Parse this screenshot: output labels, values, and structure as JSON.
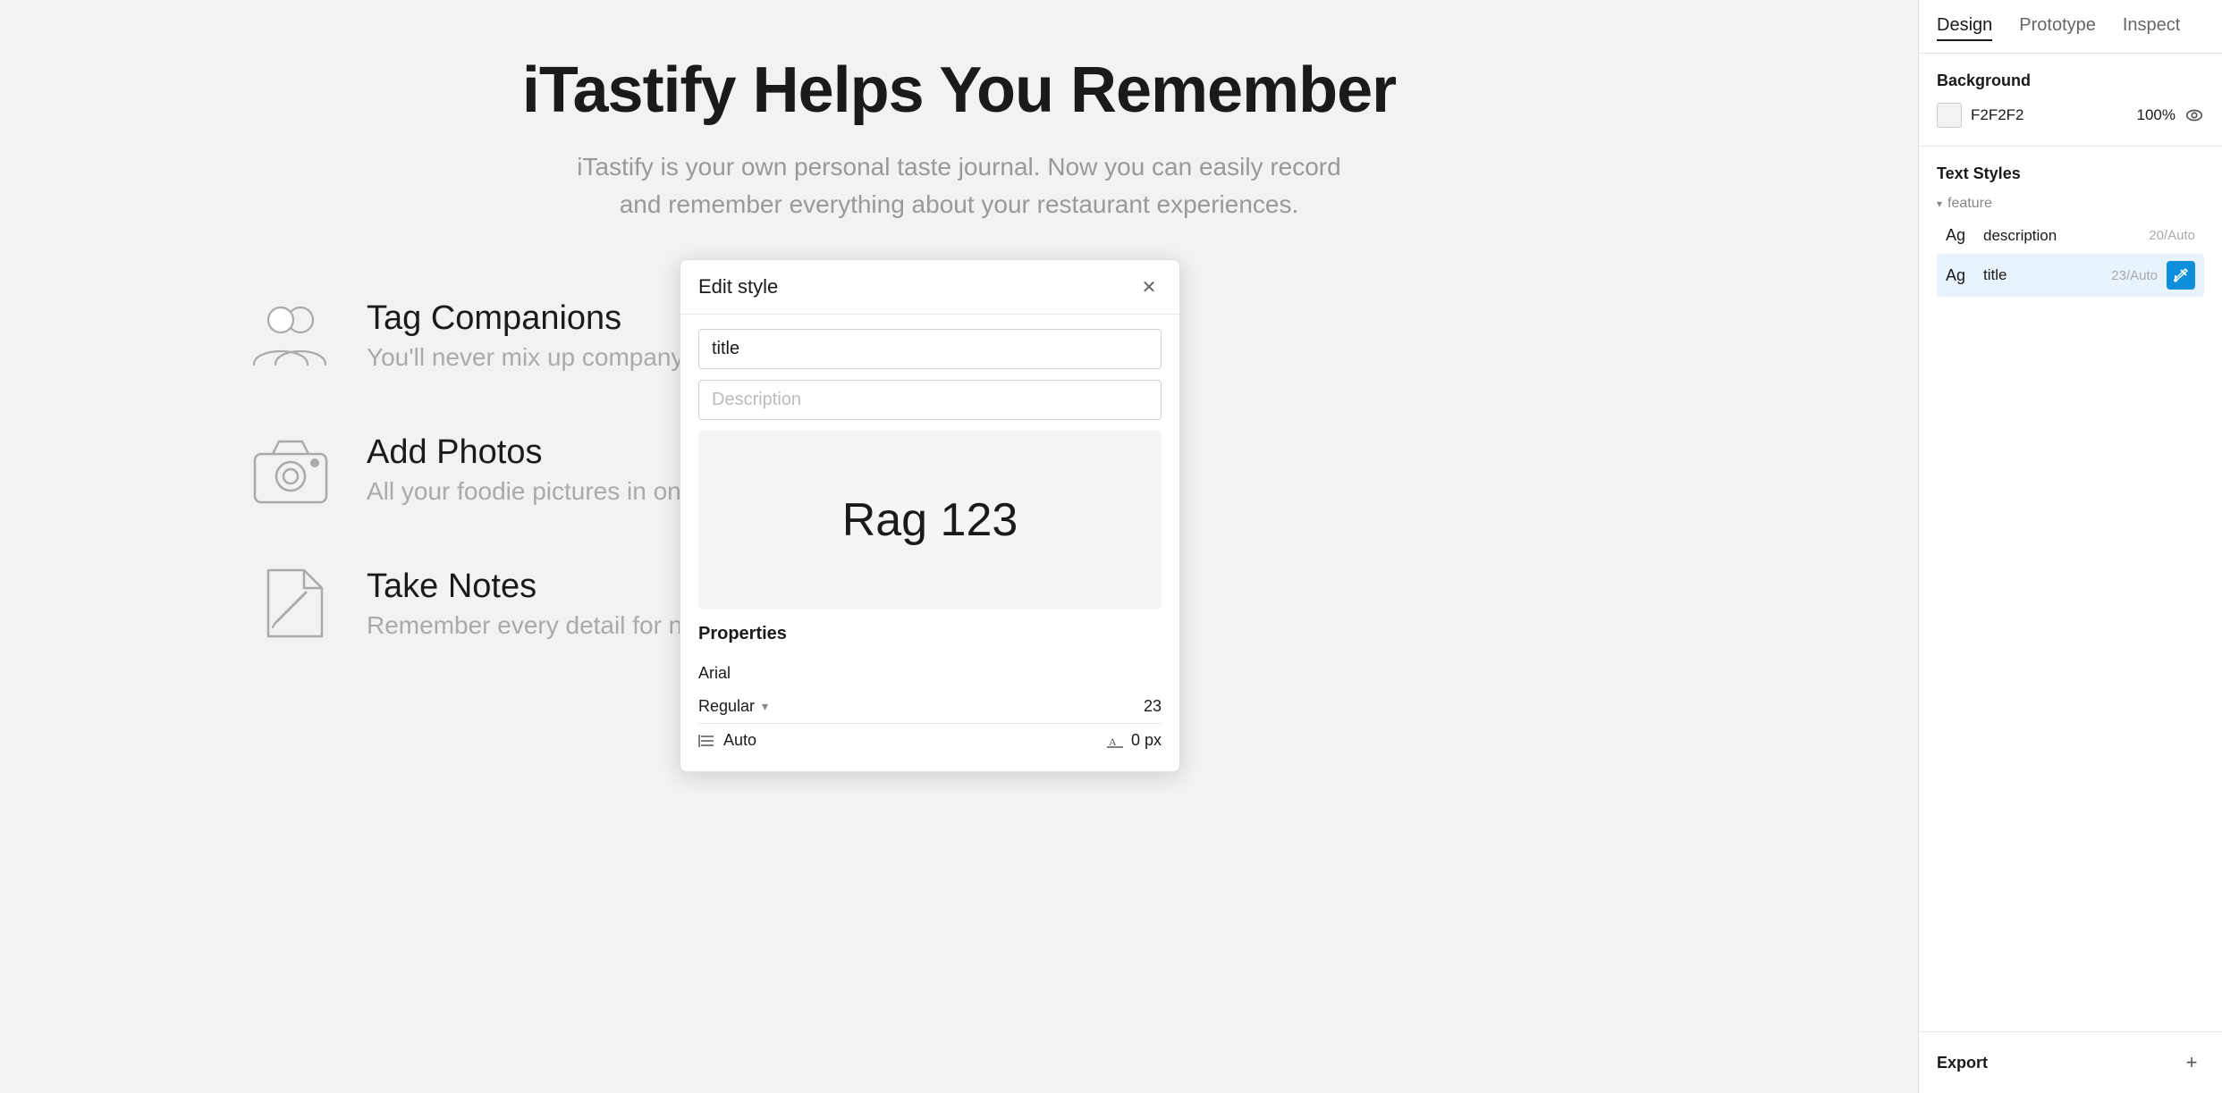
{
  "canvas": {
    "background_color": "#F2F2F2",
    "main_title": "iTastify Helps You Remember",
    "main_subtitle": "iTastify is your own personal taste journal. Now you can easily record and remember everything about your restaurant experiences.",
    "features": [
      {
        "id": "tag-companions",
        "icon": "people-icon",
        "title": "Tag Companions",
        "description": "You'll never mix up company again."
      },
      {
        "id": "add-photos",
        "icon": "camera-icon",
        "title": "Add Photos",
        "description": "All your foodie pictures in one app."
      },
      {
        "id": "take-notes",
        "icon": "note-icon",
        "title": "Take Notes",
        "description": "Remember every detail for next time."
      }
    ]
  },
  "edit_style_modal": {
    "title": "Edit style",
    "name_value": "title",
    "description_placeholder": "Description",
    "preview_text": "Rag 123",
    "properties_title": "Properties",
    "font_family": "Arial",
    "font_weight": "Regular",
    "font_size": "23",
    "line_height_label": "Auto",
    "letter_spacing_label": "0 px"
  },
  "right_panel": {
    "tabs": [
      {
        "id": "design",
        "label": "Design",
        "active": true
      },
      {
        "id": "prototype",
        "label": "Prototype",
        "active": false
      },
      {
        "id": "inspect",
        "label": "Inspect",
        "active": false
      }
    ],
    "background_section": {
      "title": "Background",
      "color_hex": "F2F2F2",
      "opacity": "100%"
    },
    "text_styles_section": {
      "title": "Text Styles",
      "groups": [
        {
          "name": "feature",
          "items": [
            {
              "ag": "Ag",
              "name": "description",
              "info": "20/Auto",
              "active": false
            },
            {
              "ag": "Ag",
              "name": "title",
              "info": "23/Auto",
              "active": true
            }
          ]
        }
      ]
    },
    "export_section": {
      "title": "Export",
      "add_label": "+"
    }
  }
}
